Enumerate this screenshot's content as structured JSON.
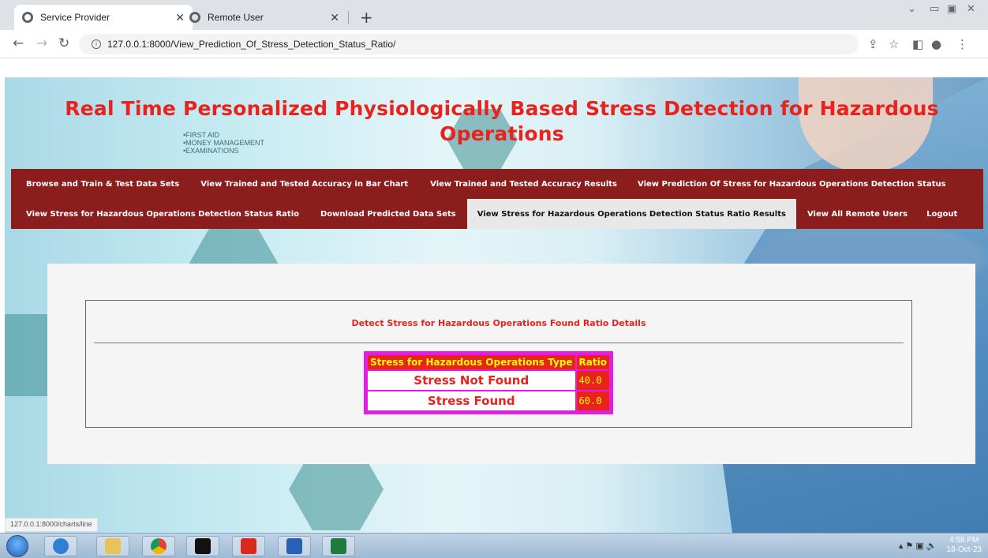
{
  "browser": {
    "tabs": [
      {
        "title": "Service Provider",
        "active": true
      },
      {
        "title": "Remote User",
        "active": false
      }
    ],
    "url": "127.0.0.1:8000/View_Prediction_Of_Stress_Detection_Status_Ratio/",
    "status_url": "127.0.0.1:8000/charts/line"
  },
  "site": {
    "title": "Real Time Personalized Physiologically Based Stress Detection for Hazardous Operations",
    "background_text": [
      "•FIRST AID",
      "•MONEY MANAGEMENT",
      "•EXAMINATIONS"
    ]
  },
  "menu": {
    "row1": [
      "Browse and Train & Test Data Sets",
      "View Trained and Tested Accuracy in Bar Chart",
      "View Trained and Tested Accuracy Results",
      "View Prediction Of Stress for Hazardous Operations Detection Status"
    ],
    "row2": [
      "View Stress for Hazardous Operations Detection Status Ratio",
      "Download Predicted Data Sets",
      "View Stress for Hazardous Operations Detection Status Ratio Results",
      "View All Remote Users",
      "Logout"
    ],
    "active": "View Stress for Hazardous Operations Detection Status Ratio Results"
  },
  "content": {
    "heading": "Detect Stress for Hazardous Operations Found Ratio Details",
    "table": {
      "headers": [
        "Stress for Hazardous Operations Type",
        "Ratio"
      ],
      "rows": [
        {
          "type": "Stress Not Found",
          "ratio": "40.0"
        },
        {
          "type": "Stress Found",
          "ratio": "60.0"
        }
      ]
    }
  },
  "taskbar": {
    "time": "4:58 PM",
    "date": "18-Oct-23"
  },
  "colors": {
    "title_red": "#e8221c",
    "menu_bg": "#8b1d1d",
    "table_border": "#e31ee3",
    "ratio_text": "#ffff00"
  }
}
